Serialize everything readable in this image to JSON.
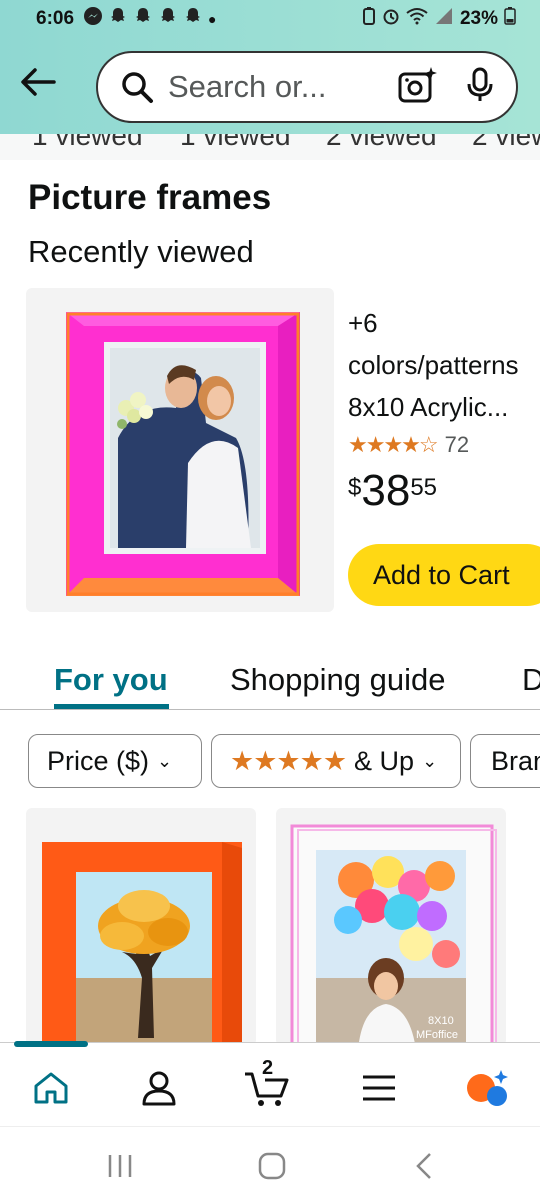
{
  "status_bar": {
    "time": "6:06",
    "battery": "23%"
  },
  "search": {
    "placeholder": "Search or..."
  },
  "peek_strip": [
    "1 viewed",
    "1 viewed",
    "2 viewed",
    "2 view"
  ],
  "section": {
    "title": "Picture frames",
    "subtitle": "Recently viewed"
  },
  "recent_item": {
    "colors_line1": "+6",
    "colors_line2": "colors/patterns",
    "title": "8x10 Acrylic...",
    "stars": "★★★★☆",
    "rating_count": "72",
    "price_currency": "$",
    "price_whole": "38",
    "price_fraction": "55",
    "add_to_cart": "Add to Cart"
  },
  "tabs": [
    {
      "label": "For you",
      "active": true
    },
    {
      "label": "Shopping guide",
      "active": false
    },
    {
      "label": "D",
      "active": false
    }
  ],
  "filters": {
    "price": "Price ($)",
    "stars": "★★★★★",
    "stars_suffix": "& Up",
    "brand": "Bran"
  },
  "grid_items": [
    {
      "caption_line1": "",
      "caption_line2": ""
    },
    {
      "caption_line1": "8X10",
      "caption_line2": "MFoffice"
    }
  ],
  "bottom_nav": {
    "cart_count": "2"
  },
  "colors": {
    "accent": "#007185",
    "cta": "#ffd814",
    "star": "#de7921",
    "header": "#a6e4d6"
  }
}
